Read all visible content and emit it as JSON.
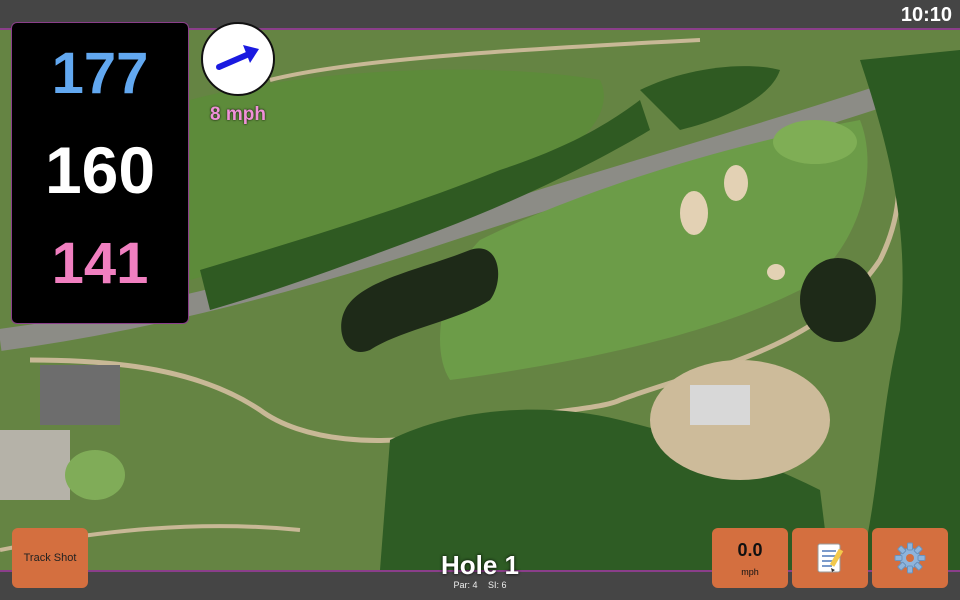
{
  "status": {
    "time": "10:10"
  },
  "distances": {
    "back": "177",
    "middle": "160",
    "front": "141"
  },
  "wind": {
    "speed": "8 mph",
    "direction_icon": "wind-arrow-icon"
  },
  "hole": {
    "title": "Hole 1",
    "par": "Par: 4",
    "si": "SI: 6"
  },
  "buttons": {
    "track_shot": "Track Shot",
    "speed_value": "0.0",
    "speed_unit": "mph",
    "notes_icon": "notepad-icon",
    "settings_icon": "gear-icon"
  },
  "colors": {
    "back": "#62a8f0",
    "middle": "#ffffff",
    "front": "#f07fc0",
    "accent": "#d46f3f",
    "frame": "#8a3e8a"
  }
}
